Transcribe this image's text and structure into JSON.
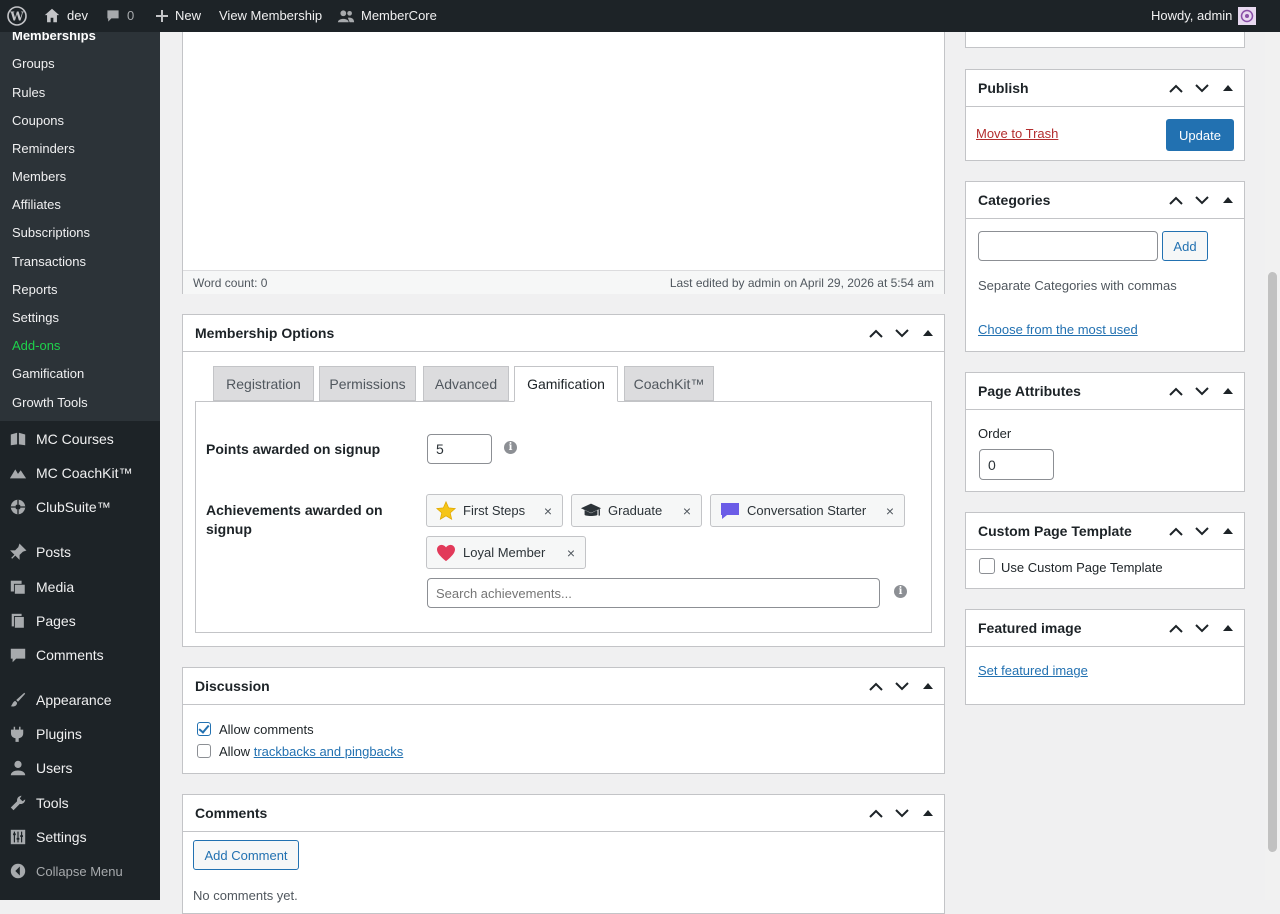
{
  "adminbar": {
    "site_name": "dev",
    "comments_count": "0",
    "new_label": "New",
    "view_label": "View Membership",
    "plugin_label": "MemberCore",
    "greeting": "Howdy, admin"
  },
  "sidebar": {
    "submenu": [
      "Memberships",
      "Groups",
      "Rules",
      "Coupons",
      "Reminders",
      "Members",
      "Affiliates",
      "Subscriptions",
      "Transactions",
      "Reports",
      "Settings",
      "Add-ons",
      "Gamification",
      "Growth Tools"
    ],
    "menu": [
      "MC Courses",
      "MC CoachKit™",
      "ClubSuite™",
      "Posts",
      "Media",
      "Pages",
      "Comments",
      "Appearance",
      "Plugins",
      "Users",
      "Tools",
      "Settings",
      "Collapse Menu"
    ]
  },
  "editor": {
    "word_count": "Word count: 0",
    "last_edited": "Last edited by admin on April 29, 2026 at 5:54 am"
  },
  "membership_options": {
    "title": "Membership Options",
    "tabs": [
      "Registration",
      "Permissions",
      "Advanced",
      "Gamification",
      "CoachKit™"
    ],
    "active_tab": "Gamification",
    "points_label": "Points awarded on signup",
    "points_value": "5",
    "achievements_label": "Achievements awarded on signup",
    "achievements": [
      {
        "label": "First Steps",
        "icon": "star-icon"
      },
      {
        "label": "Graduate",
        "icon": "graduation-cap-icon"
      },
      {
        "label": "Conversation Starter",
        "icon": "chat-bubble-icon"
      },
      {
        "label": "Loyal Member",
        "icon": "heart-icon"
      }
    ],
    "search_placeholder": "Search achievements..."
  },
  "discussion": {
    "title": "Discussion",
    "allow_comments": "Allow comments",
    "allow_prefix": "Allow",
    "trackbacks_link": "trackbacks and pingbacks"
  },
  "comments": {
    "title": "Comments",
    "add_button": "Add Comment",
    "empty": "No comments yet."
  },
  "publish": {
    "title": "Publish",
    "trash_link": "Move to Trash",
    "update_button": "Update"
  },
  "categories": {
    "title": "Categories",
    "add_button": "Add",
    "hint": "Separate Categories with commas",
    "most_used_link": "Choose from the most used"
  },
  "page_attributes": {
    "title": "Page Attributes",
    "order_label": "Order",
    "order_value": "0"
  },
  "custom_template": {
    "title": "Custom Page Template",
    "checkbox_label": "Use Custom Page Template"
  },
  "featured_image": {
    "title": "Featured image",
    "link": "Set featured image"
  },
  "colors": {
    "admin_bar": "#1d2327",
    "submenu_bg": "#2c3338",
    "accent": "#2271b1",
    "addons_green": "#1ed14b",
    "trash_red": "#b32d2e"
  }
}
